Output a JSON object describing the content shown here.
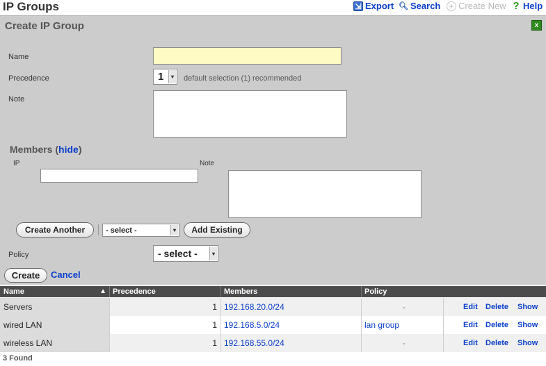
{
  "header": {
    "title": "IP Groups",
    "actions": {
      "export": "Export",
      "search": "Search",
      "create_new": "Create New",
      "help": "Help"
    }
  },
  "form": {
    "title": "Create IP Group",
    "close_label": "x",
    "name_label": "Name",
    "name_value": "",
    "precedence_label": "Precedence",
    "precedence_value": "1",
    "precedence_hint": "default selection (1) recommended",
    "note_label": "Note",
    "note_value": "",
    "members": {
      "heading": "Members (",
      "hide_link": "hide",
      "heading_close": ")",
      "ip_label": "IP",
      "ip_value": "",
      "note_label": "Note",
      "note_value": ""
    },
    "create_another": "Create Another",
    "existing_select": "- select -",
    "add_existing": "Add Existing",
    "policy_label": "Policy",
    "policy_select": "- select -",
    "create_button": "Create",
    "cancel_link": "Cancel"
  },
  "table": {
    "columns": {
      "name": "Name",
      "sort_indicator": "▲",
      "precedence": "Precedence",
      "members": "Members",
      "policy": "Policy"
    },
    "rows": [
      {
        "name": "Servers",
        "precedence": "1",
        "members": "192.168.20.0/24",
        "policy": "-",
        "edit": "Edit",
        "delete": "Delete",
        "show": "Show"
      },
      {
        "name": "wired LAN",
        "precedence": "1",
        "members": "192.168.5.0/24",
        "policy": "lan group",
        "edit": "Edit",
        "delete": "Delete",
        "show": "Show"
      },
      {
        "name": "wireless LAN",
        "precedence": "1",
        "members": "192.168.55.0/24",
        "policy": "-",
        "edit": "Edit",
        "delete": "Delete",
        "show": "Show"
      }
    ],
    "found": "3 Found"
  },
  "icons": {
    "export": "export-icon",
    "search": "magnifier-icon",
    "create_new": "plus-circle-icon",
    "help": "question-mark-icon"
  },
  "colors": {
    "link": "#0b3fcc",
    "panel": "#cccccc",
    "name_field": "#fffbc4",
    "header_bar": "#4b4b4b"
  }
}
